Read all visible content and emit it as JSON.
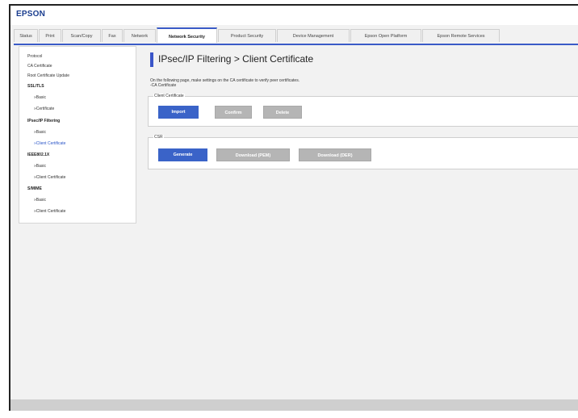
{
  "header": {
    "logo": "EPSON"
  },
  "tabs": [
    {
      "label": "Status"
    },
    {
      "label": "Print"
    },
    {
      "label": "Scan/Copy"
    },
    {
      "label": "Fax"
    },
    {
      "label": "Network"
    },
    {
      "label": "Network Security"
    },
    {
      "label": "Product Security"
    },
    {
      "label": "Device Management"
    },
    {
      "label": "Epson Open Platform"
    },
    {
      "label": "Epson Remote Services"
    }
  ],
  "sidebar": {
    "items": [
      {
        "label": "Protocol"
      },
      {
        "label": "CA Certificate"
      },
      {
        "label": "Root Certificate Update"
      },
      {
        "label": "SSL/TLS"
      },
      {
        "label": "»Basic"
      },
      {
        "label": "»Certificate"
      },
      {
        "label": "IPsec/IP Filtering"
      },
      {
        "label": "»Basic"
      },
      {
        "label": "»Client Certificate"
      },
      {
        "label": "IEEE802.1X"
      },
      {
        "label": "»Basic"
      },
      {
        "label": "»Client Certificate"
      },
      {
        "label": "S/MIME"
      },
      {
        "label": "»Basic"
      },
      {
        "label": "»Client Certificate"
      }
    ]
  },
  "main": {
    "title": "IPsec/IP Filtering > Client Certificate",
    "description_line1": "On the following page, make settings on the CA certificate to verify peer certificates.",
    "description_line2": "-CA Certificate",
    "client_cert_section": {
      "legend": "Client Certificate",
      "import_label": "Import",
      "confirm_label": "Confirm",
      "delete_label": "Delete"
    },
    "csr_section": {
      "legend": "CSR",
      "generate_label": "Generate",
      "download_pem_label": "Download (PEM)",
      "download_der_label": "Download (DER)"
    }
  },
  "colors": {
    "accent": "#3a63c8",
    "brand": "#1a3d8f",
    "disabled": "#b5b5b5"
  }
}
